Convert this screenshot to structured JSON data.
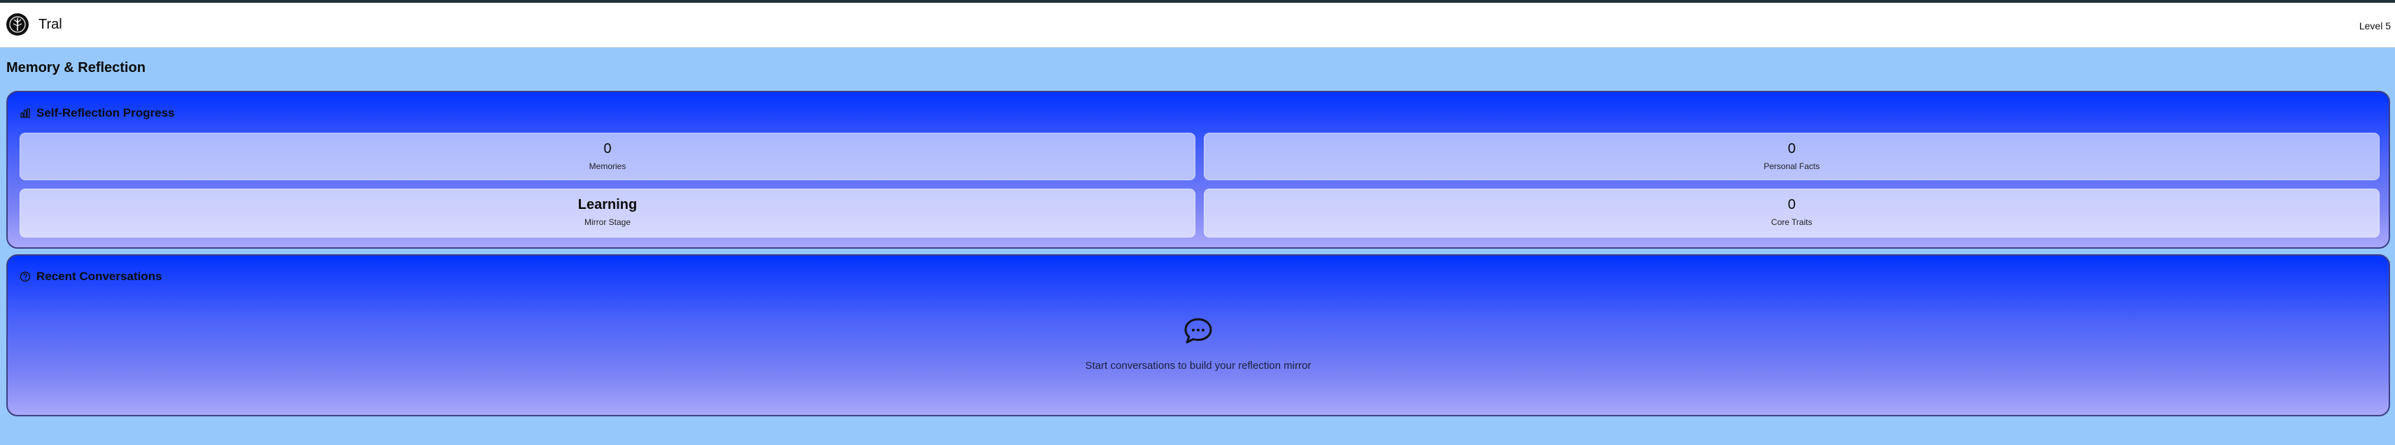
{
  "header": {
    "app_name": "Tral",
    "logo_icon": "tree-circle-logo",
    "level_label": "Level 5"
  },
  "page": {
    "title": "Memory & Reflection"
  },
  "progress": {
    "title": "Self-Reflection Progress",
    "icon": "chart-icon",
    "stats": [
      {
        "value": "0",
        "label": "Memories"
      },
      {
        "value": "0",
        "label": "Personal Facts"
      },
      {
        "value": "Learning",
        "label": "Mirror Stage"
      },
      {
        "value": "0",
        "label": "Core Traits"
      }
    ]
  },
  "recent": {
    "title": "Recent Conversations",
    "icon": "question-circle-icon",
    "empty_icon": "chat-bubble-icon",
    "empty_message": "Start conversations to build your reflection mirror"
  },
  "colors": {
    "background": "#97c8fb",
    "card_gradient_top": "#0232ff",
    "card_gradient_bottom": "#a9a8fa",
    "header_bg": "#ffffff"
  }
}
